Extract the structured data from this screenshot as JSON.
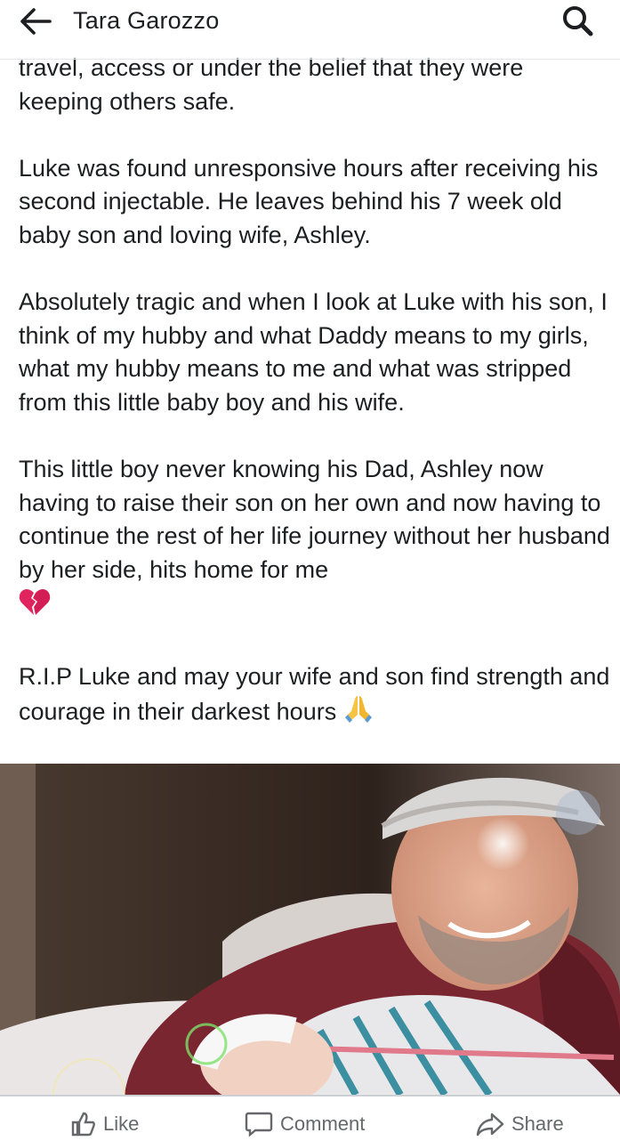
{
  "header": {
    "title": "Tara Garozzo",
    "back_icon": "arrow-left-icon",
    "search_icon": "search-icon"
  },
  "post": {
    "paragraphs": [
      "travel, access or under the belief that they were keeping others safe.",
      "Luke was found unresponsive hours after receiving his second injectable.  He leaves behind his 7 week old baby son and loving wife, Ashley.",
      "Absolutely tragic and when I look at Luke with his son, I think of my hubby and what Daddy means to my girls, what my hubby means to me and what was stripped from this little baby boy and his wife.",
      "This little boy never knowing his Dad, Ashley now having to raise their son on her own and now having to continue the rest of her life journey without her husband by her side, hits home for me",
      "R.I.P Luke and may your wife and son find strength and courage in their darkest hours"
    ],
    "emoji_broken_heart": "broken-heart-icon",
    "emoji_praying_hands": "praying-hands-icon"
  },
  "actions": {
    "like_label": "Like",
    "comment_label": "Comment",
    "share_label": "Share"
  },
  "colors": {
    "text": "#1c1e21",
    "muted": "#65676b",
    "divider": "#e4e6eb"
  }
}
